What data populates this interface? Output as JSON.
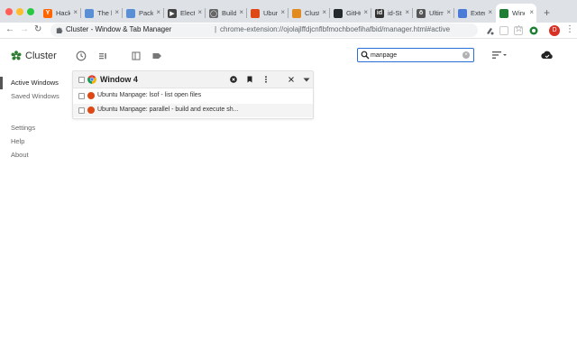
{
  "browser": {
    "tabs": [
      {
        "title": "Hacke",
        "fav_color": "#ff6600",
        "fav_glyph": "Y"
      },
      {
        "title": "The l",
        "fav_color": "#5a8fd6",
        "fav_glyph": ""
      },
      {
        "title": "Packa",
        "fav_color": "#5a8fd6",
        "fav_glyph": ""
      },
      {
        "title": "Electr",
        "fav_color": "#444444",
        "fav_glyph": "▶"
      },
      {
        "title": "Buildi",
        "fav_color": "#666666",
        "fav_glyph": "◯"
      },
      {
        "title": "Ubun",
        "fav_color": "#dd4814",
        "fav_glyph": ""
      },
      {
        "title": "Clust",
        "fav_color": "#e08a1f",
        "fav_glyph": ""
      },
      {
        "title": "GitHu",
        "fav_color": "#24292e",
        "fav_glyph": ""
      },
      {
        "title": "id-St",
        "fav_color": "#333333",
        "fav_glyph": "id"
      },
      {
        "title": "Ultim",
        "fav_color": "#555555",
        "fav_glyph": "ö"
      },
      {
        "title": "Exter",
        "fav_color": "#4a7bd6",
        "fav_glyph": ""
      },
      {
        "title": "Wind",
        "fav_color": "#1e7e34",
        "fav_glyph": ""
      }
    ],
    "omnibox": {
      "title": "Cluster - Window & Tab Manager",
      "divider": "|",
      "url": "chrome-extension://ojolajlffdjcnflbfmochboefihafbid/manager.html#active"
    },
    "profile_initial": "D"
  },
  "app": {
    "brand": "Cluster",
    "search": {
      "value": "manpage",
      "placeholder": ""
    },
    "sidebar": [
      {
        "label": "Active Windows",
        "active": true
      },
      {
        "label": "Saved Windows",
        "active": false
      },
      {
        "label": "Settings",
        "active": false
      },
      {
        "label": "Help",
        "active": false
      },
      {
        "label": "About",
        "active": false
      }
    ],
    "window_card": {
      "title": "Window 4",
      "tabs": [
        {
          "title": "Ubuntu Manpage: lsof - list open files"
        },
        {
          "title": "Ubuntu Manpage: parallel - build and execute sh..."
        }
      ]
    }
  }
}
